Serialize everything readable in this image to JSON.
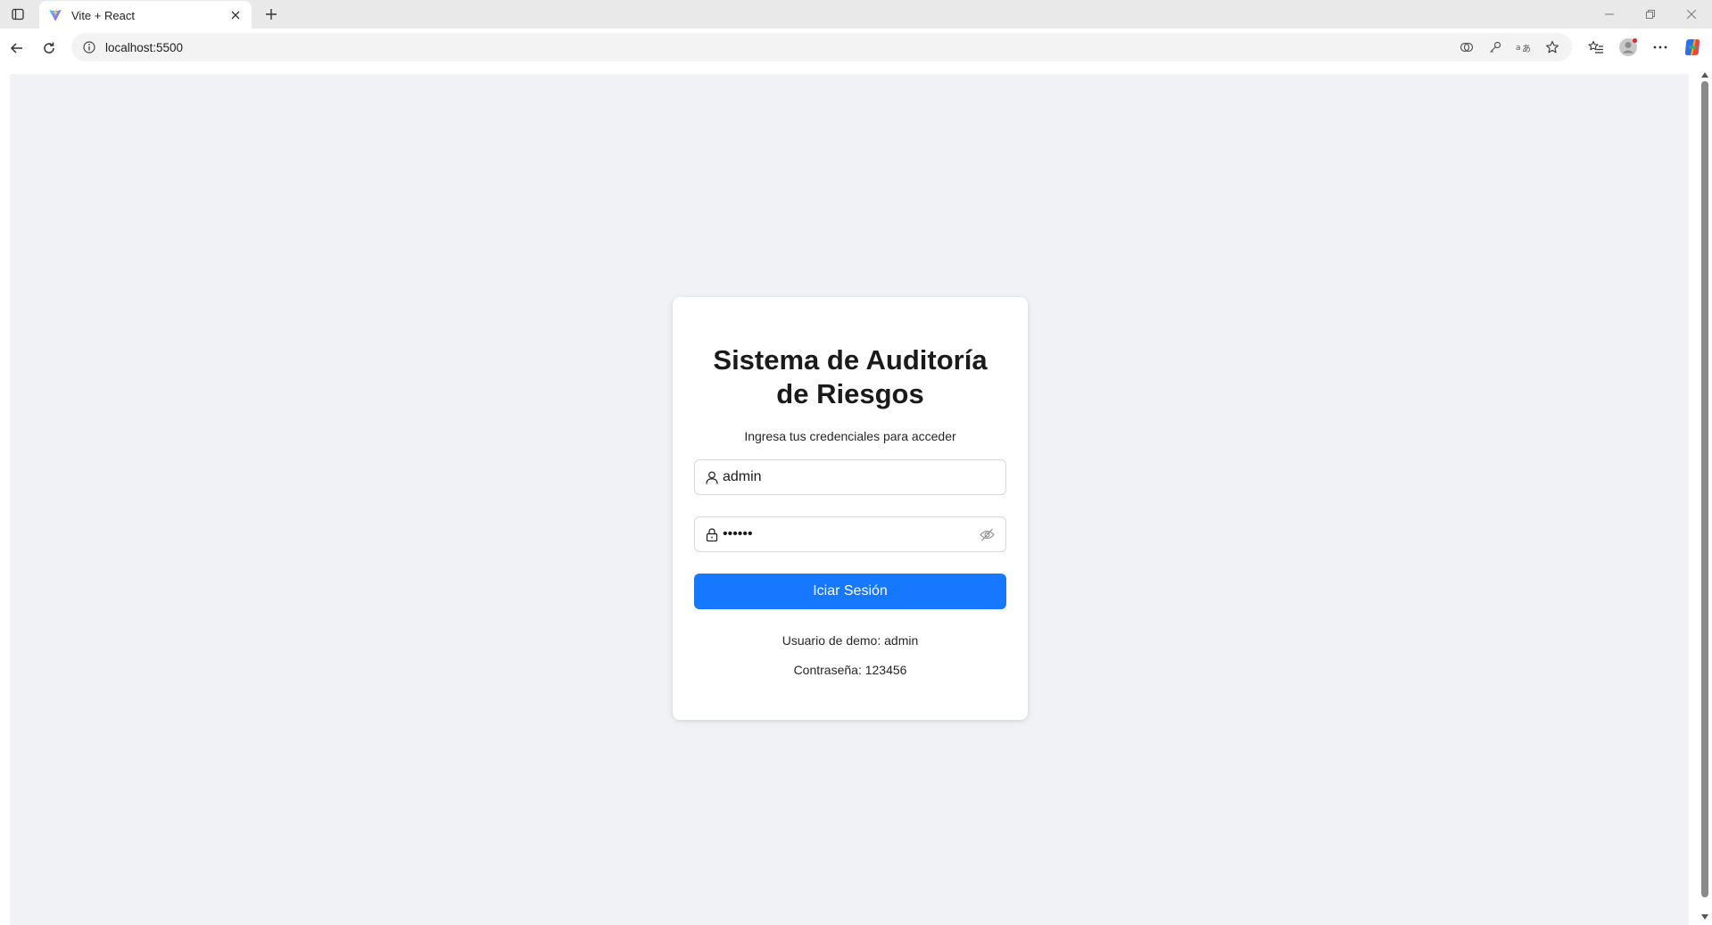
{
  "browser": {
    "tab_title": "Vite + React",
    "url": "localhost:5500"
  },
  "login": {
    "title": "Sistema de Auditoría de Riesgos",
    "subtitle": "Ingresa tus credenciales para acceder",
    "username_value": "admin",
    "password_value": "123456",
    "submit_label": "Iciar Sesión",
    "demo_user": "Usuario de demo: admin",
    "demo_password": "Contraseña: 123456"
  },
  "colors": {
    "primary": "#1677ff",
    "page_background": "#f0f2f5"
  },
  "icons": {
    "user_field": "user-icon",
    "password_field": "lock-icon",
    "password_toggle": "eye-off-icon"
  }
}
